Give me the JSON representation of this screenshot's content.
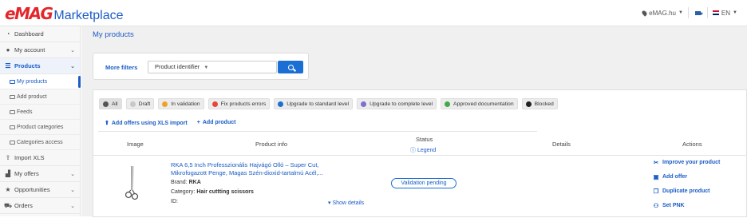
{
  "header": {
    "logo_brand": "eMAG",
    "logo_product": "Marketplace",
    "store": "eMAG.hu",
    "language": "EN"
  },
  "sidebar": {
    "items": [
      {
        "label": "Dashboard",
        "icon": "dashboard-icon"
      },
      {
        "label": "My account",
        "icon": "user-icon"
      },
      {
        "label": "Products",
        "icon": "list-icon"
      },
      {
        "label": "Import XLS",
        "icon": "upload-icon"
      },
      {
        "label": "My offers",
        "icon": "chart-icon"
      },
      {
        "label": "Opportunities",
        "icon": "star-icon"
      },
      {
        "label": "Orders",
        "icon": "cart-icon"
      }
    ],
    "products_sub": [
      "My products",
      "Add product",
      "Feeds",
      "Product categories",
      "Categories access"
    ]
  },
  "main": {
    "title": "My products",
    "more_filters": "More filters",
    "filter_select": "Product identifier",
    "chips": [
      {
        "label": "All",
        "color": "#555555"
      },
      {
        "label": "Draft",
        "color": "#c8c8c8"
      },
      {
        "label": "In validation",
        "color": "#f0a12b"
      },
      {
        "label": "Fix products errors",
        "color": "#e5453d"
      },
      {
        "label": "Upgrade to standard level",
        "color": "#1b6fd4"
      },
      {
        "label": "Upgrade to complete level",
        "color": "#7b6fd0"
      },
      {
        "label": "Approved documentation",
        "color": "#43a84a"
      },
      {
        "label": "Blocked",
        "color": "#222222"
      }
    ],
    "actions": {
      "import": "Add offers using XLS import",
      "add_product": "Add product"
    },
    "table": {
      "headers": {
        "image": "Image",
        "product_info": "Product info",
        "status": "Status",
        "legend": "Legend",
        "details": "Details",
        "actions": "Actions"
      },
      "row": {
        "title": "RKA 6,5 Inch Professzionális Hajvágó Olló – Super Cut, Mikrofogazott Penge, Magas Szén-dioxid-tartalmú Acél,...",
        "brand_label": "Brand:",
        "brand": "RKA",
        "category_label": "Category:",
        "category": "Hair cuttting scissors",
        "id_label": "ID:",
        "show_details": "Show details",
        "status": "Validation pending",
        "actions": [
          "Improve your product",
          "Add offer",
          "Duplicate product",
          "Set PNK"
        ]
      }
    }
  }
}
